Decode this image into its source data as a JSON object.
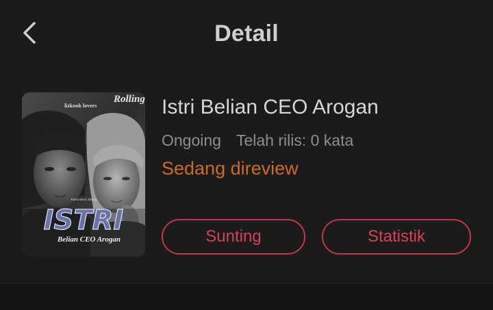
{
  "header": {
    "title": "Detail",
    "back_icon": "chevron-left-icon"
  },
  "book": {
    "title": "Istri Belian CEO Arogan",
    "status": "Ongoing",
    "released": "Telah rilis: 0 kata",
    "review_status": "Sedang direview",
    "cover": {
      "main_title": "ISTRI",
      "subtitle": "Belian CEO Arogan",
      "top_left_text": "lizkook lovers",
      "top_right_text": "Rolling",
      "small_caption": "Kalau benci bilang"
    }
  },
  "actions": {
    "edit_label": "Sunting",
    "stats_label": "Statistik"
  },
  "colors": {
    "background": "#1b1b1c",
    "accent": "#c9344d",
    "review": "#d2691e"
  }
}
